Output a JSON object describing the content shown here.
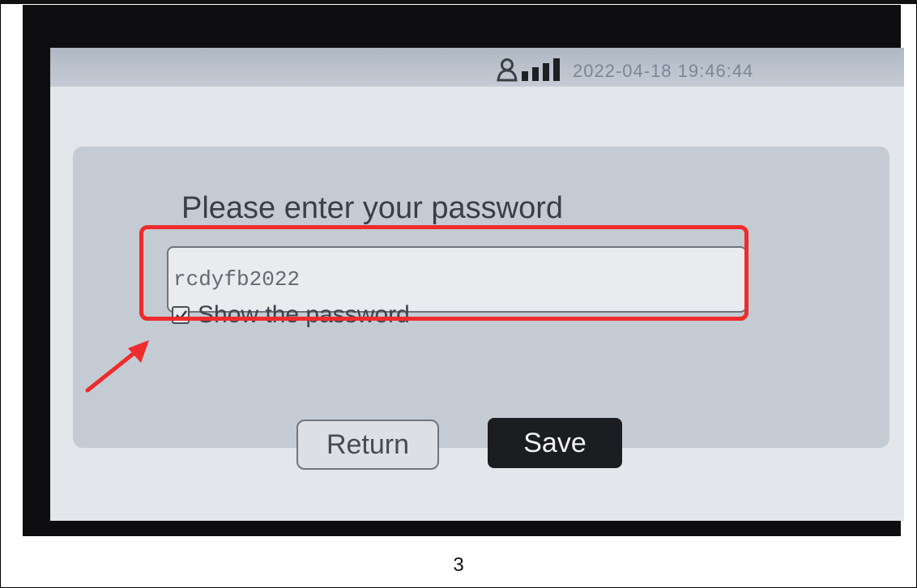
{
  "status_bar": {
    "datetime": "2022-04-18 19:46:44",
    "icons": [
      "user-icon",
      "signal-icon"
    ]
  },
  "dialog": {
    "prompt": "Please enter your password",
    "password_value": "rcdyfb2022",
    "show_password_checked": true,
    "show_password_label": "Show the password"
  },
  "buttons": {
    "return_label": "Return",
    "save_label": "Save"
  },
  "annotation": {
    "color": "#ef2b2b"
  },
  "page_number": "3"
}
